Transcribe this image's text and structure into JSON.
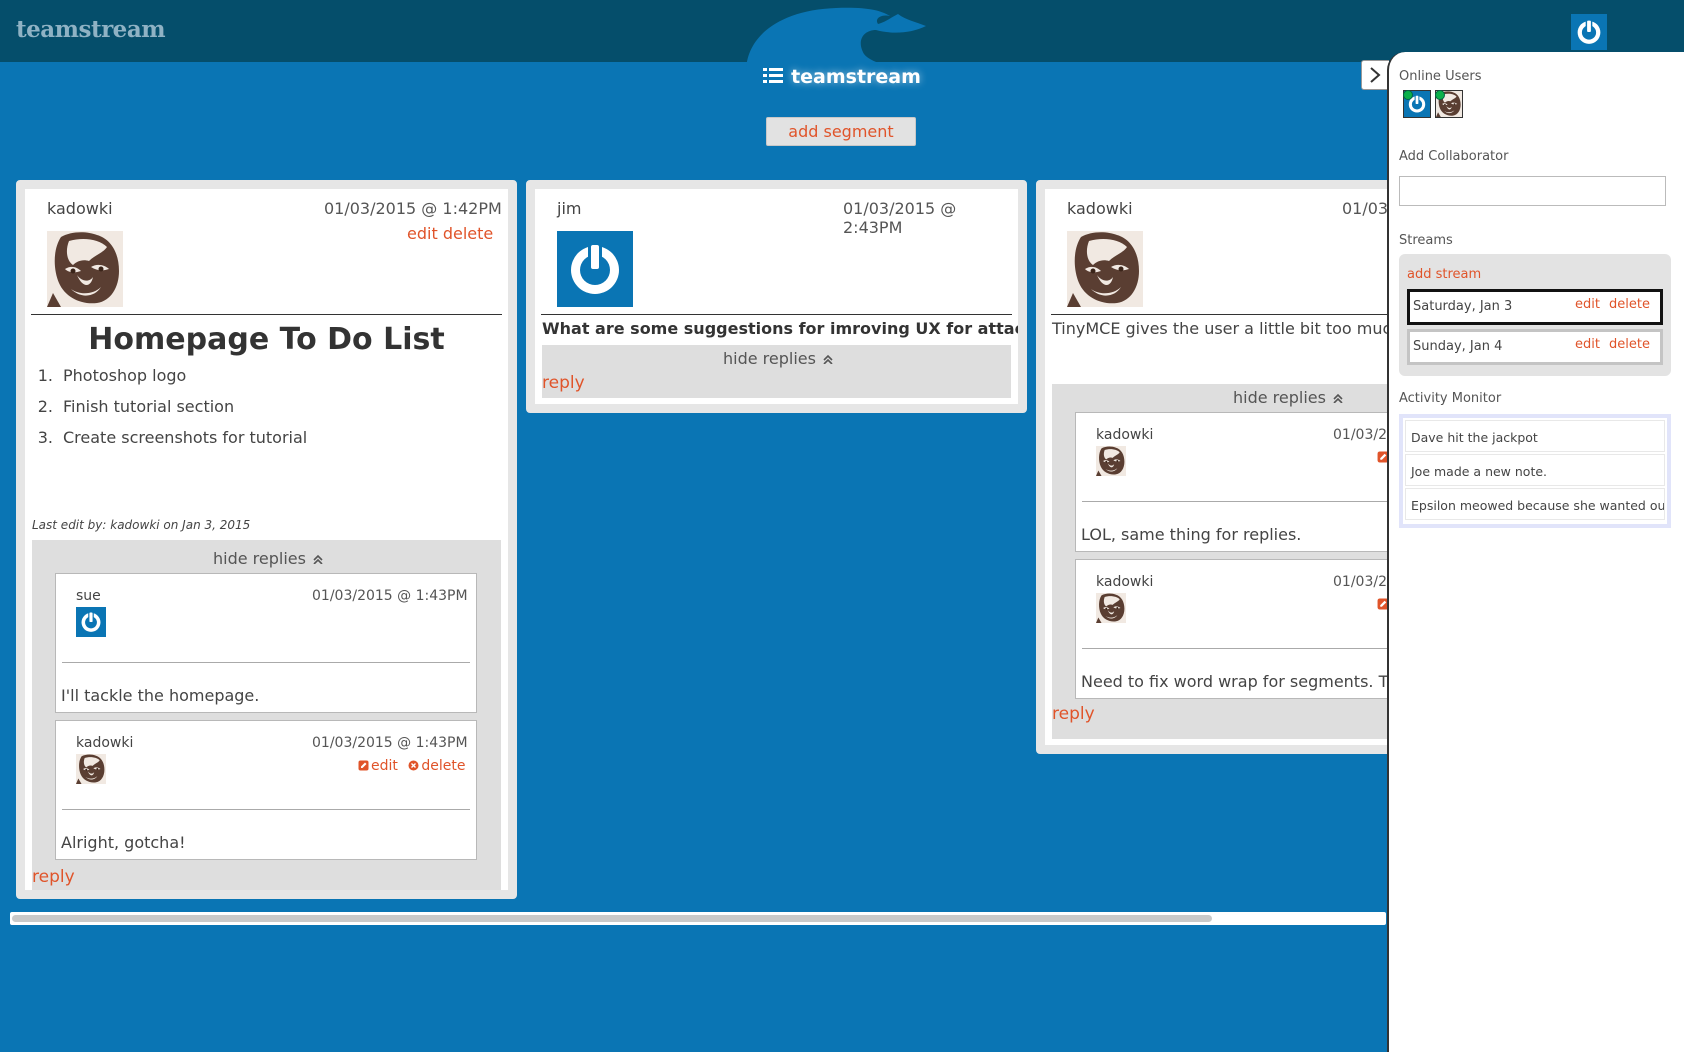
{
  "header": {
    "brand": "teamstream",
    "center_title": "teamstream",
    "add_segment_label": "add segment"
  },
  "colors": {
    "topbar": "#054e6b",
    "background": "#0a75b4",
    "accent": "#e0542a",
    "online_dot": "#0bb04a"
  },
  "segments": [
    {
      "author": "kadowki",
      "date": "01/03/2015 @ 1:42PM",
      "edit_label": "edit",
      "delete_label": "delete",
      "title": "Homepage To Do List",
      "list": [
        {
          "num": "1.",
          "text": "Photoshop logo"
        },
        {
          "num": "2.",
          "text": "Finish tutorial section"
        },
        {
          "num": "3.",
          "text": "Create screenshots for tutorial"
        }
      ],
      "last_edit": "Last edit by: kadowki on Jan 3, 2015",
      "hide_replies_label": "hide replies",
      "reply_label": "reply",
      "replies": [
        {
          "author": "sue",
          "date": "01/03/2015 @ 1:43PM",
          "text": "I'll tackle the homepage."
        },
        {
          "author": "kadowki",
          "date": "01/03/2015 @ 1:43PM",
          "edit_label": "edit",
          "delete_label": "delete",
          "text": "Alright, gotcha!"
        }
      ]
    },
    {
      "author": "jim",
      "date": "01/03/2015 @ 2:43PM",
      "body": "What are some suggestions for imroving UX for attachments?",
      "hide_replies_label": "hide replies",
      "reply_label": "reply"
    },
    {
      "author": "kadowki",
      "date": "01/03",
      "body": "TinyMCE gives the user a little bit too much fl",
      "hide_replies_label": "hide replies",
      "reply_label": "reply",
      "replies": [
        {
          "author": "kadowki",
          "date": "01/03/2",
          "text": "LOL, same thing for replies."
        },
        {
          "author": "kadowki",
          "date": "01/03/2",
          "text": "Need to fix word wrap for segments. This"
        }
      ]
    }
  ],
  "sidebar": {
    "online_users_label": "Online Users",
    "add_collaborator_label": "Add Collaborator",
    "collaborator_input_value": "",
    "streams_label": "Streams",
    "add_stream_label": "add stream",
    "streams": [
      {
        "name": "Saturday, Jan 3",
        "edit_label": "edit",
        "delete_label": "delete",
        "active": true
      },
      {
        "name": "Sunday, Jan 4",
        "edit_label": "edit",
        "delete_label": "delete",
        "active": false
      }
    ],
    "activity_label": "Activity Monitor",
    "activity": [
      "Dave hit the jackpot",
      "Joe made a new note.",
      "Epsilon meowed because she wanted out."
    ]
  },
  "icons": [
    "power-icon",
    "face-avatar",
    "list-icon",
    "chevron-up-icon",
    "chevron-right-icon",
    "edit-icon",
    "delete-circle-icon"
  ]
}
